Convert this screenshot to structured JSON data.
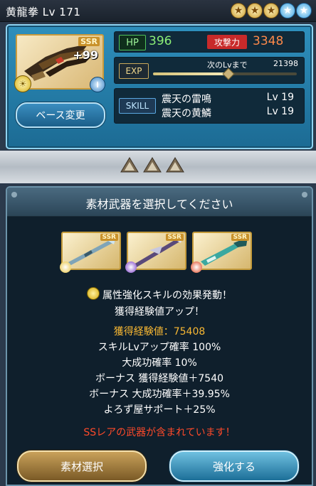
{
  "header": {
    "title": "黄龍拳 Lv 171",
    "stars": [
      {
        "icon": "gold-star-icon",
        "glyph": "★"
      },
      {
        "icon": "gold-star-icon",
        "glyph": "★"
      },
      {
        "icon": "gold-star-icon",
        "glyph": "★"
      },
      {
        "icon": "blue-star-icon",
        "glyph": "★"
      },
      {
        "icon": "blue-star-icon",
        "glyph": "★"
      }
    ]
  },
  "weapon": {
    "rarity": "SSR",
    "plus": "+99",
    "elem_glyph": "☀",
    "info_glyph": "i",
    "base_change_label": "ベース変更"
  },
  "stats": {
    "hp_label": "HP",
    "hp_value": "396",
    "atk_label": "攻撃力",
    "atk_value": "3348",
    "exp_label": "EXP",
    "next_label": "次のLvまで",
    "next_value": "21398",
    "exp_progress": 0.52,
    "skill_label": "SKILL",
    "skills": [
      {
        "name": "震天の雷鳴",
        "level": "Lv 19"
      },
      {
        "name": "震天の黄鱗",
        "level": "Lv 19"
      }
    ]
  },
  "panel": {
    "title": "素材武器を選択してください",
    "materials": [
      {
        "rarity": "SSR",
        "element": "light",
        "color": "#e8c23a"
      },
      {
        "rarity": "SSR",
        "element": "dark",
        "color": "#7a3cc8"
      },
      {
        "rarity": "SSR",
        "element": "fire",
        "color": "#e0441e"
      }
    ],
    "notice_1": "属性強化スキルの効果発動！",
    "notice_2": "獲得経験値アップ！",
    "gain": "獲得経験値：75408",
    "lines": [
      "スキルLvアップ確率 100%",
      "大成功確率 10%",
      "ボーナス 獲得経験値＋7540",
      "ボーナス 大成功確率＋39.95%",
      "よろず屋サポート＋25%"
    ],
    "warning": "SSレアの武器が含まれています！",
    "material_select_label": "素材選択",
    "upgrade_label": "強化する"
  },
  "colors": {
    "accent_blue": "#2e8fbc",
    "gold": "#f7b733",
    "warning_red": "#ff4a2a"
  }
}
